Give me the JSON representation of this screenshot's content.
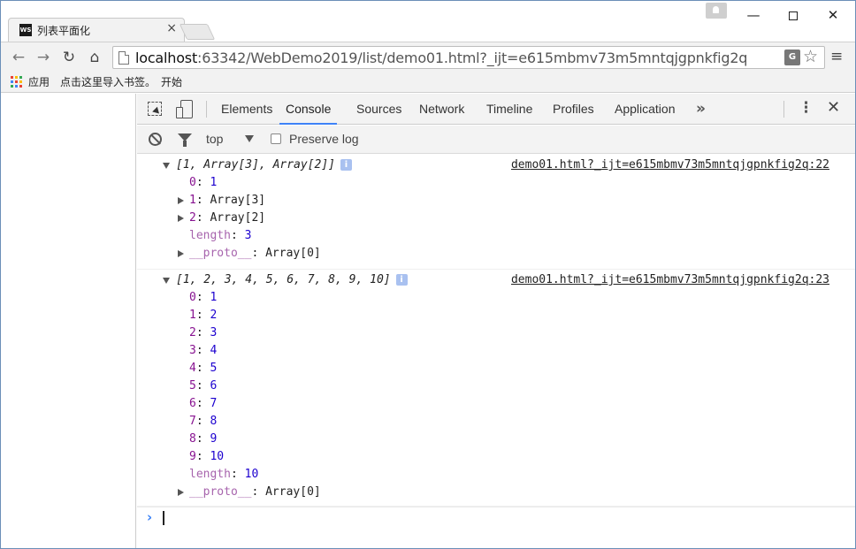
{
  "browser": {
    "tab": {
      "favicon": "WS",
      "title": "列表平面化"
    },
    "window_controls": {
      "minimize": "—",
      "maximize": "☐",
      "close": "✕"
    },
    "url_host": "localhost",
    "url_rest": ":63342/WebDemo2019/list/demo01.html?_ijt=e615mbmv73m5mntqjgpnkfig2q",
    "bookmarks": [
      {
        "label": "应用"
      },
      {
        "label": "点击这里导入书签。"
      },
      {
        "label": "开始"
      }
    ],
    "icons": {
      "back": "arrow-left-icon",
      "forward": "arrow-right-icon",
      "reload": "reload-icon",
      "home": "home-icon",
      "translate": "translate-icon",
      "star": "star-icon",
      "menu": "menu-icon"
    },
    "translate_glyph": "G",
    "star_glyph": "☆",
    "menu_glyph": "≡",
    "apps_colors": [
      "#e94235",
      "#fbbc04",
      "#34a853",
      "#4285f4",
      "#e94235",
      "#fbbc04",
      "#34a853",
      "#4285f4",
      "#e94235"
    ]
  },
  "devtools": {
    "tabs": [
      "Elements",
      "Console",
      "Sources",
      "Network",
      "Timeline",
      "Profiles",
      "Application"
    ],
    "active_tab": "Console",
    "more": "»",
    "kebab": "⋮",
    "close": "✕",
    "accent_color": "#3e82f7",
    "console_toolbar": {
      "context": "top",
      "preserve_log_label": "Preserve log",
      "preserve_log_checked": false
    },
    "messages": [
      {
        "summary": "[1, Array[3], Array[2]]",
        "source": "demo01.html?_ijt=e615mbmv73m5mntqjgpnkfig2q:22",
        "entries": [
          {
            "key": "0",
            "value": "1",
            "expandable": false
          },
          {
            "key": "1",
            "value": "Array[3]",
            "expandable": true
          },
          {
            "key": "2",
            "value": "Array[2]",
            "expandable": true
          }
        ],
        "length": {
          "key": "length",
          "value": "3"
        },
        "proto": {
          "key": "__proto__",
          "value": "Array[0]"
        }
      },
      {
        "summary": "[1, 2, 3, 4, 5, 6, 7, 8, 9, 10]",
        "source": "demo01.html?_ijt=e615mbmv73m5mntqjgpnkfig2q:23",
        "entries": [
          {
            "key": "0",
            "value": "1"
          },
          {
            "key": "1",
            "value": "2"
          },
          {
            "key": "2",
            "value": "3"
          },
          {
            "key": "3",
            "value": "4"
          },
          {
            "key": "4",
            "value": "5"
          },
          {
            "key": "5",
            "value": "6"
          },
          {
            "key": "6",
            "value": "7"
          },
          {
            "key": "7",
            "value": "8"
          },
          {
            "key": "8",
            "value": "9"
          },
          {
            "key": "9",
            "value": "10"
          }
        ],
        "length": {
          "key": "length",
          "value": "10"
        },
        "proto": {
          "key": "__proto__",
          "value": "Array[0]"
        }
      }
    ],
    "prompt": "›"
  }
}
